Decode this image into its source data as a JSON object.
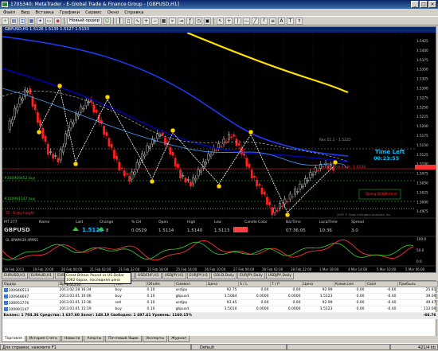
{
  "app": {
    "title": "1705340: MetaTrader - E-Global Trade & Finance Group - [GBPUSD,H1]"
  },
  "menu": [
    "Файл",
    "Вид",
    "Вставка",
    "Графики",
    "Сервис",
    "Окно",
    "Справка"
  ],
  "toolbar": {
    "new_order": "Новый ордер"
  },
  "chart": {
    "header": "GBPUSD,H1  1.5126 1.5135 1.5127 1.5133",
    "labels": {
      "time_left_label": "Time Left",
      "time_left_value": "00:23:55",
      "level_upper": "Res 51.1 - 1.5225",
      "level_mid": "Fib 61.8 - 1.5134",
      "level_low1": "#100969452 buy",
      "level_low2": "#100961147 buy",
      "strong_down": "Strong DOWN trend",
      "mt": "MT 277",
      "lower_left": "TS - Firstly Insight",
      "footer_note": "2007 © Forex Indicators Analytics, Inc."
    },
    "price_axis": [
      "1.5425",
      "1.5400",
      "1.5375",
      "1.5350",
      "1.5325",
      "1.5300",
      "1.5275",
      "1.5250",
      "1.5225",
      "1.5200",
      "1.5175",
      "1.5150",
      "1.5125",
      "1.5100",
      "1.5075",
      "1.5050",
      "1.5025",
      "1.5000",
      "1.4975"
    ],
    "info_bar": {
      "headers": [
        "Name",
        "Last",
        "Change",
        "% CH",
        "Open",
        "High",
        "Low",
        "Candle Color",
        "BarTime",
        "LocalTime",
        "Spread"
      ],
      "values": [
        "GBPUSD",
        "1.5123",
        "8",
        "0.0529",
        "1.5114",
        "1.5140",
        "1.5113",
        "",
        "07:36:05",
        "10:36",
        "3.0"
      ]
    },
    "osc_label": "GL 4PWM·DR 4PMSS",
    "osc_axis": [
      "100.0",
      "50.0",
      "0.0"
    ],
    "time_axis": [
      "19 Feb 2013",
      "19 Feb 10:00",
      "20 Feb 06:00",
      "21 Feb 02:00",
      "21 Feb 22:00",
      "22 Feb 18:00",
      "25 Feb 14:00",
      "26 Feb 10:00",
      "27 Feb 06:00",
      "28 Feb 02:00",
      "28 Feb 22:00",
      "1 Mar 18:00",
      "4 Mar 14:00",
      "5 Mar 10:00",
      "5 Mar 06:00"
    ]
  },
  "chart_tabs": [
    "EURUSD,H1",
    "EURAUD,H1",
    "EURGBP,H1",
    "GBPUSD,H1",
    "AUDUSD,H1",
    "USDCHF,H1",
    "USDJPY,H1",
    "EURJPY,H1",
    "GOLD,Daily",
    "EURJPY,Daily",
    "USDJPY,Daily"
  ],
  "tooltip": {
    "line1": "Great Britain Pound vs US Dollar",
    "line2": "1062 барах, последняя цена 1.51230"
  },
  "terminal": {
    "headers": [
      "Ордер",
      "Время",
      "Тип",
      "Объём",
      "Символ",
      "Цена",
      "S / L",
      "T / P",
      "Цена",
      "Комиссия",
      "Своп",
      "Прибыль"
    ],
    "rows": [
      [
        "100946513",
        "2013.02.28 16:34",
        "buy",
        "0.10",
        "usdjpy",
        "92.75",
        "0.00",
        "0.00",
        "92.99",
        "0.00",
        "-0.60",
        "25.81"
      ],
      [
        "100948697",
        "2013.03.01 10:06",
        "buy",
        "0.10",
        "gbpusd",
        "1.5084",
        "0.0000",
        "0.0000",
        "1.5123",
        "0.00",
        "-0.40",
        "39.00"
      ],
      [
        "100951776",
        "2013.03.01 13:36",
        "sell",
        "0.10",
        "usdjpy",
        "93.45",
        "0.00",
        "0.00",
        "92.99",
        "0.00",
        "-0.40",
        "49.47"
      ],
      [
        "100991147",
        "2013.03.01 15:19",
        "buy",
        "0.10",
        "gbpusd",
        "1.5010",
        "0.0000",
        "0.0000",
        "1.5123",
        "0.00",
        "-0.40",
        "113.00"
      ]
    ],
    "balance": "Баланс: 1 704.36  Средства: 1 637.60  Залог: 148.19  Свободно: 1 497.41  Уровень: 1160.15%",
    "balance_profit": "-66.76"
  },
  "terminal_tabs": [
    "Торговля",
    "История Счета",
    "Новости",
    "Алерты",
    "Почтовый Ящик",
    "Эксперты",
    "Журнал"
  ],
  "status": {
    "help": "Для справки, нажмите F1",
    "profile": "Default",
    "traffic": "421/4 kb"
  },
  "colors": {
    "bull_candle": "#ffffff",
    "bear_candle": "#ff2020",
    "ma_slow": "#ffe100",
    "ma_blue": "#1e3cff",
    "ma_navy": "#0000b4",
    "zigzag": "#ffffff",
    "marker": "#ffd200",
    "osc_red": "#ff3030",
    "osc_green": "#30c030",
    "time_left": "#00c0ff"
  }
}
